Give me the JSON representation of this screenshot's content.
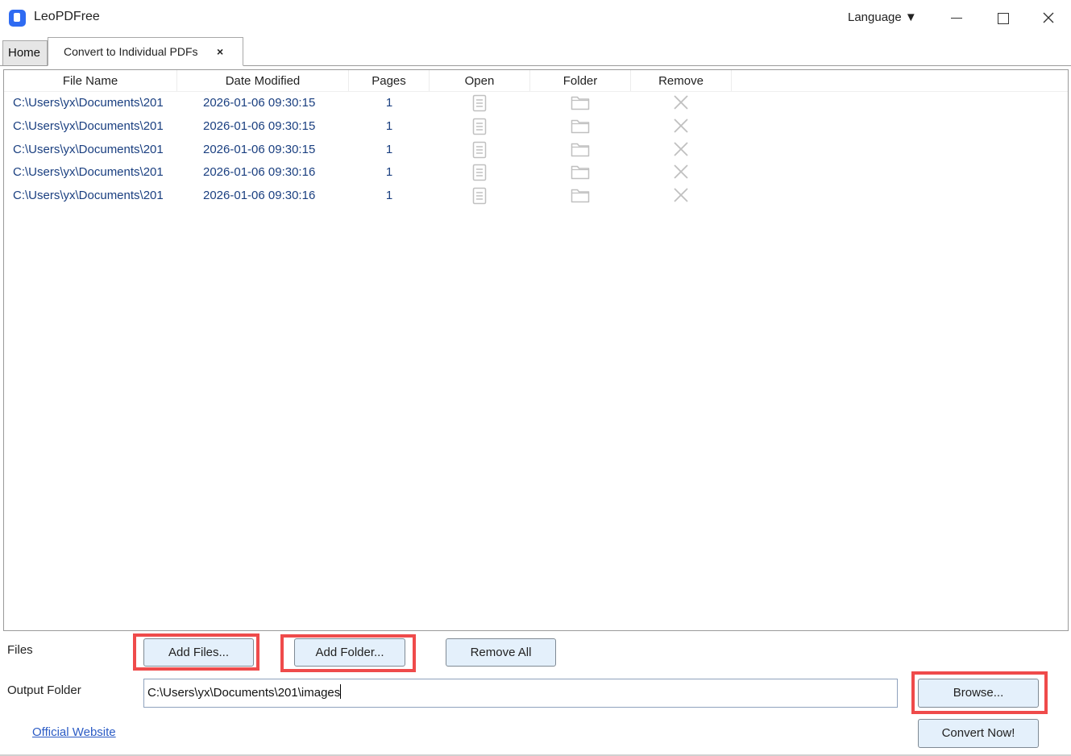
{
  "window": {
    "title": "LeoPDFree",
    "language_label": "Language ▼"
  },
  "tabs": [
    {
      "label": "Home"
    },
    {
      "label": "Convert to Individual PDFs",
      "close": "×"
    }
  ],
  "table": {
    "columns": [
      "File Name",
      "Date Modified",
      "Pages",
      "Open",
      "Folder",
      "Remove"
    ],
    "rows": [
      {
        "file": "C:\\Users\\yx\\Documents\\201",
        "date": "2026-01-06 09:30:15",
        "pages": "1"
      },
      {
        "file": "C:\\Users\\yx\\Documents\\201",
        "date": "2026-01-06 09:30:15",
        "pages": "1"
      },
      {
        "file": "C:\\Users\\yx\\Documents\\201",
        "date": "2026-01-06 09:30:15",
        "pages": "1"
      },
      {
        "file": "C:\\Users\\yx\\Documents\\201",
        "date": "2026-01-06 09:30:16",
        "pages": "1"
      },
      {
        "file": "C:\\Users\\yx\\Documents\\201",
        "date": "2026-01-06 09:30:16",
        "pages": "1"
      }
    ],
    "icons": {
      "open": "document-icon",
      "folder": "folder-icon",
      "remove": "remove-x-icon"
    }
  },
  "files": {
    "label": "Files",
    "add_files": "Add Files...",
    "add_folder": "Add Folder...",
    "remove_all": "Remove All"
  },
  "output": {
    "label": "Output Folder",
    "value": "C:\\Users\\yx\\Documents\\201\\images",
    "browse": "Browse..."
  },
  "convert_now": "Convert Now!",
  "official_website": "Official Website",
  "colors": {
    "accent": "#2f6bf2",
    "button_bg": "#e4f0fb",
    "highlight": "#ef4b4b",
    "row_text": "#1a3f80",
    "icon_gray": "#c0c0c0"
  }
}
